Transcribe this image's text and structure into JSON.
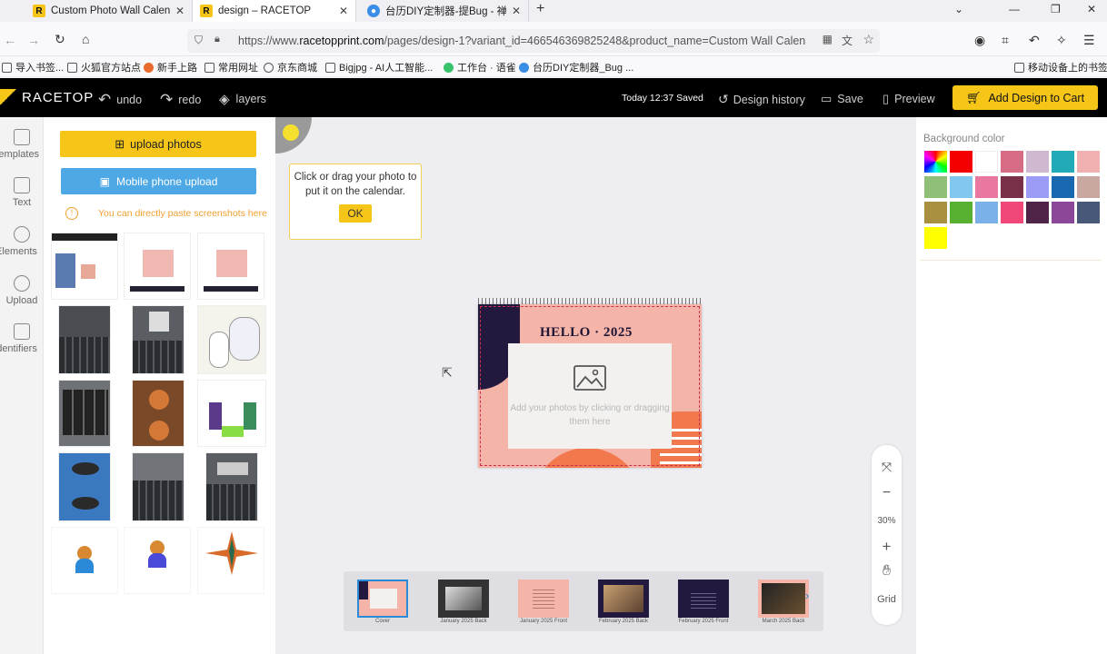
{
  "browser": {
    "tabs": [
      {
        "title": "Custom Photo Wall Calendar"
      },
      {
        "title": "design – RACETOP"
      },
      {
        "title": "台历DIY定制器-提Bug - 禅道"
      }
    ],
    "url_prefix": "https://www.",
    "url_domain": "racetopprint.com",
    "url_path": "/pages/design-1?variant_id=466546369825248&product_name=Custom Wall Calen",
    "bookmarks": [
      "导入书签...",
      "火狐官方站点",
      "新手上路",
      "常用网址",
      "京东商城",
      "Bigjpg - AI人工智能...",
      "工作台 · 语雀",
      "台历DIY定制器_Bug ...",
      "移动设备上的书签"
    ]
  },
  "header": {
    "logo": "RACETOP",
    "undo": "undo",
    "redo": "redo",
    "layers": "layers",
    "saved_status": "Today 12:37 Saved",
    "design_history": "Design history",
    "save": "Save",
    "preview": "Preview",
    "add_to_cart": "Add Design to Cart"
  },
  "rail": [
    "Templates",
    "Text",
    "Elements",
    "Upload",
    "Identifiers"
  ],
  "upload_panel": {
    "upload_photos": "upload photos",
    "mobile_upload": "Mobile phone upload",
    "hint": "You can directly paste screenshots here"
  },
  "tooltip": {
    "text": "Click or drag your photo to put it on the calendar.",
    "ok": "OK"
  },
  "calendar": {
    "title": "HELLO · 2025",
    "placeholder": "Add your photos by clicking or dragging them here"
  },
  "zoom": {
    "level": "30%",
    "grid": "Grid"
  },
  "pages": [
    {
      "label": "Cover"
    },
    {
      "label": "January 2025 Back"
    },
    {
      "label": "January 2025 Front"
    },
    {
      "label": "February 2025 Back"
    },
    {
      "label": "February 2025 Front"
    },
    {
      "label": "March 2025 Back"
    }
  ],
  "background_panel": {
    "title": "Background color",
    "swatches": [
      "#ffffff",
      "#f50000",
      "#ffffff",
      "#d86c84",
      "#d0b8d0",
      "#23aab8",
      "#f0b0b0",
      "#90c078",
      "#80c8f0",
      "#e878a0",
      "#7a3048",
      "#9c9cf8",
      "#1a68b0",
      "#c8a8a0",
      "#a89040",
      "#58b030",
      "#7cb0e8",
      "#f04878",
      "#502448",
      "#8c4898",
      "#485878",
      "#ffff00"
    ]
  }
}
